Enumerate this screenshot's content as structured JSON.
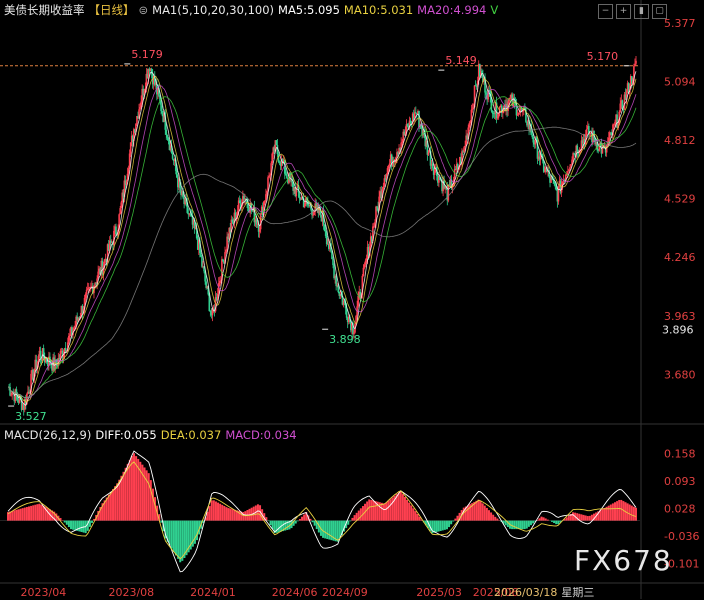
{
  "header": {
    "title": "美债长期收益率",
    "period": "【日线】",
    "ma_label": "MA1(5,10,20,30,100)",
    "ma5": "MA5:5.095",
    "ma10": "MA10:5.031",
    "ma20": "MA20:4.994",
    "ma_toggle": "V"
  },
  "macd_header": {
    "label": "MACD(26,12,9)",
    "diff": "DIFF:0.055",
    "dea": "DEA:0.037",
    "macd": "MACD:0.034"
  },
  "watermark": "FX678",
  "cursor_date": "2026/03/18",
  "cursor_weekday": "星期三",
  "colors": {
    "up": "#ff4050",
    "down": "#30d090",
    "ma5": "#ffffff",
    "ma10": "#e8d040",
    "ma20": "#d050d0",
    "ma30": "#40d040",
    "ma100": "#888888",
    "axis_text": "#e04040",
    "macd_axis": "#e04040"
  },
  "chart_data": {
    "type": "candlestick",
    "title": "美债长期收益率",
    "y_ticks": [
      "5.377",
      "5.094",
      "4.812",
      "4.529",
      "4.246",
      "3.963",
      "3.680"
    ],
    "current_price": "3.896",
    "x_ticks": [
      "2023/04",
      "2023/08",
      "2024/01",
      "2024/06",
      "2024/09",
      "2025/03",
      "2025/06"
    ],
    "annotations": [
      {
        "label": "5.179",
        "type": "high"
      },
      {
        "label": "3.527",
        "type": "low"
      },
      {
        "label": "3.898",
        "type": "low"
      },
      {
        "label": "5.149",
        "type": "high"
      },
      {
        "label": "5.170",
        "type": "high"
      }
    ],
    "reference_line": 5.17,
    "price_path": [
      [
        "2023/04",
        3.62
      ],
      [
        "2023/04",
        3.53
      ],
      [
        "2023/05",
        3.78
      ],
      [
        "2023/05",
        3.72
      ],
      [
        "2023/06",
        3.87
      ],
      [
        "2023/07",
        4.05
      ],
      [
        "2023/07",
        4.2
      ],
      [
        "2023/08",
        4.4
      ],
      [
        "2023/08",
        4.86
      ],
      [
        "2023/09",
        5.18
      ],
      [
        "2023/10",
        4.9
      ],
      [
        "2023/10",
        4.55
      ],
      [
        "2023/11",
        4.35
      ],
      [
        "2023/12",
        3.95
      ],
      [
        "2024/01",
        4.35
      ],
      [
        "2024/02",
        4.55
      ],
      [
        "2024/03",
        4.4
      ],
      [
        "2024/04",
        4.78
      ],
      [
        "2024/05",
        4.6
      ],
      [
        "2024/06",
        4.5
      ],
      [
        "2024/07",
        4.45
      ],
      [
        "2024/08",
        4.1
      ],
      [
        "2024/09",
        3.9
      ],
      [
        "2024/10",
        4.3
      ],
      [
        "2024/11",
        4.65
      ],
      [
        "2024/12",
        4.8
      ],
      [
        "2025/01",
        4.95
      ],
      [
        "2025/02",
        4.7
      ],
      [
        "2025/03",
        4.55
      ],
      [
        "2025/04",
        4.75
      ],
      [
        "2025/05",
        5.15
      ],
      [
        "2025/06",
        4.95
      ],
      [
        "2025/07",
        5.0
      ],
      [
        "2025/08",
        4.92
      ],
      [
        "2025/09",
        4.7
      ],
      [
        "2025/10",
        4.55
      ],
      [
        "2025/11",
        4.75
      ],
      [
        "2025/12",
        4.85
      ],
      [
        "2026/01",
        4.75
      ],
      [
        "2026/02",
        4.95
      ],
      [
        "2026/03",
        5.17
      ]
    ],
    "macd": {
      "y_ticks": [
        "0.158",
        "0.093",
        "0.028",
        "-0.036",
        "-0.101"
      ],
      "diff_last": 0.055,
      "dea_last": 0.037,
      "macd_last": 0.034,
      "hist": [
        0.02,
        0.03,
        0.04,
        0.02,
        -0.02,
        -0.03,
        0.04,
        0.09,
        0.16,
        0.11,
        -0.04,
        -0.1,
        -0.05,
        0.05,
        0.03,
        0.02,
        0.04,
        -0.03,
        -0.02,
        0.02,
        -0.04,
        -0.05,
        0.01,
        0.05,
        0.04,
        0.07,
        0.02,
        -0.03,
        -0.02,
        0.03,
        0.05,
        0.01,
        -0.02,
        -0.02,
        0.01,
        -0.01,
        0.02,
        0.01,
        0.03,
        0.05,
        0.03
      ]
    }
  }
}
